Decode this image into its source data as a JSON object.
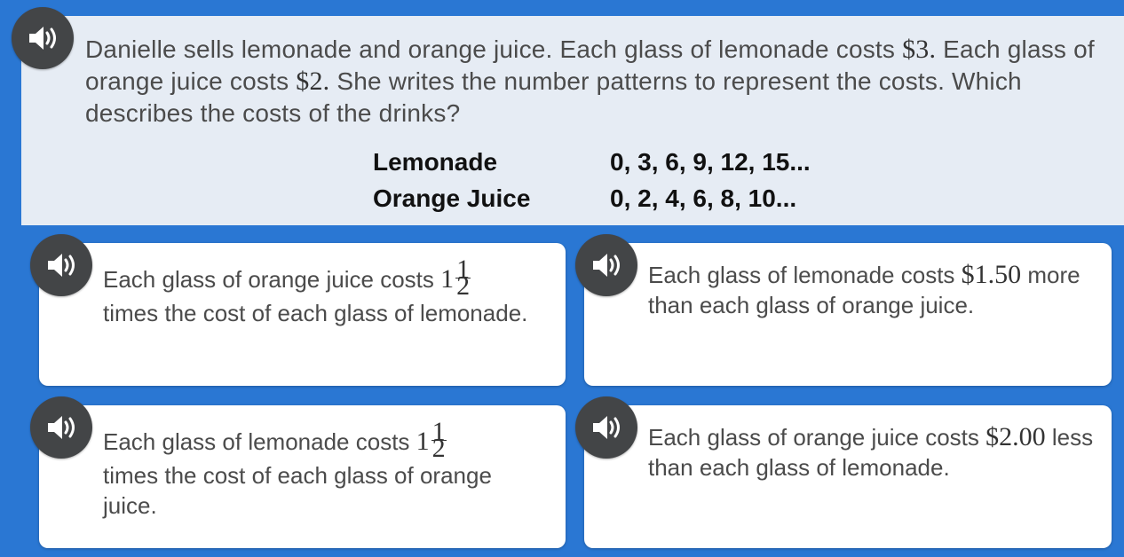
{
  "question": {
    "part1": "Danielle sells lemonade and orange juice. Each glass of lemonade costs ",
    "lemonade_price": "$3.",
    "part2": " Each glass of orange juice costs ",
    "oj_price": "$2.",
    "part3": " She writes the number patterns to represent the costs. Which describes the costs of the drinks?"
  },
  "patterns": [
    {
      "name": "Lemonade",
      "sequence": "0, 3, 6, 9, 12, 15..."
    },
    {
      "name": "Orange Juice",
      "sequence": "0, 2, 4, 6, 8, 10..."
    }
  ],
  "choices": [
    {
      "text_before": "Each glass of orange juice costs ",
      "whole": "1",
      "num": "1",
      "den": "2",
      "text_after": " times the cost of each glass of lemonade."
    },
    {
      "text_before": "Each glass of lemonade costs ",
      "amount": "$1.50",
      "text_after": " more than each glass of orange juice."
    },
    {
      "text_before": "Each glass of lemonade costs ",
      "whole": "1",
      "num": "1",
      "den": "2",
      "text_after": " times the cost of each glass of orange juice."
    },
    {
      "text_before": "Each glass of orange juice costs ",
      "amount": "$2.00",
      "text_after": " less than each glass of lemonade."
    }
  ],
  "icons": {
    "audio": "speaker-icon"
  },
  "colors": {
    "background": "#2a77d3",
    "panel": "#e6ecf4",
    "speaker": "#434547",
    "card": "#ffffff"
  }
}
